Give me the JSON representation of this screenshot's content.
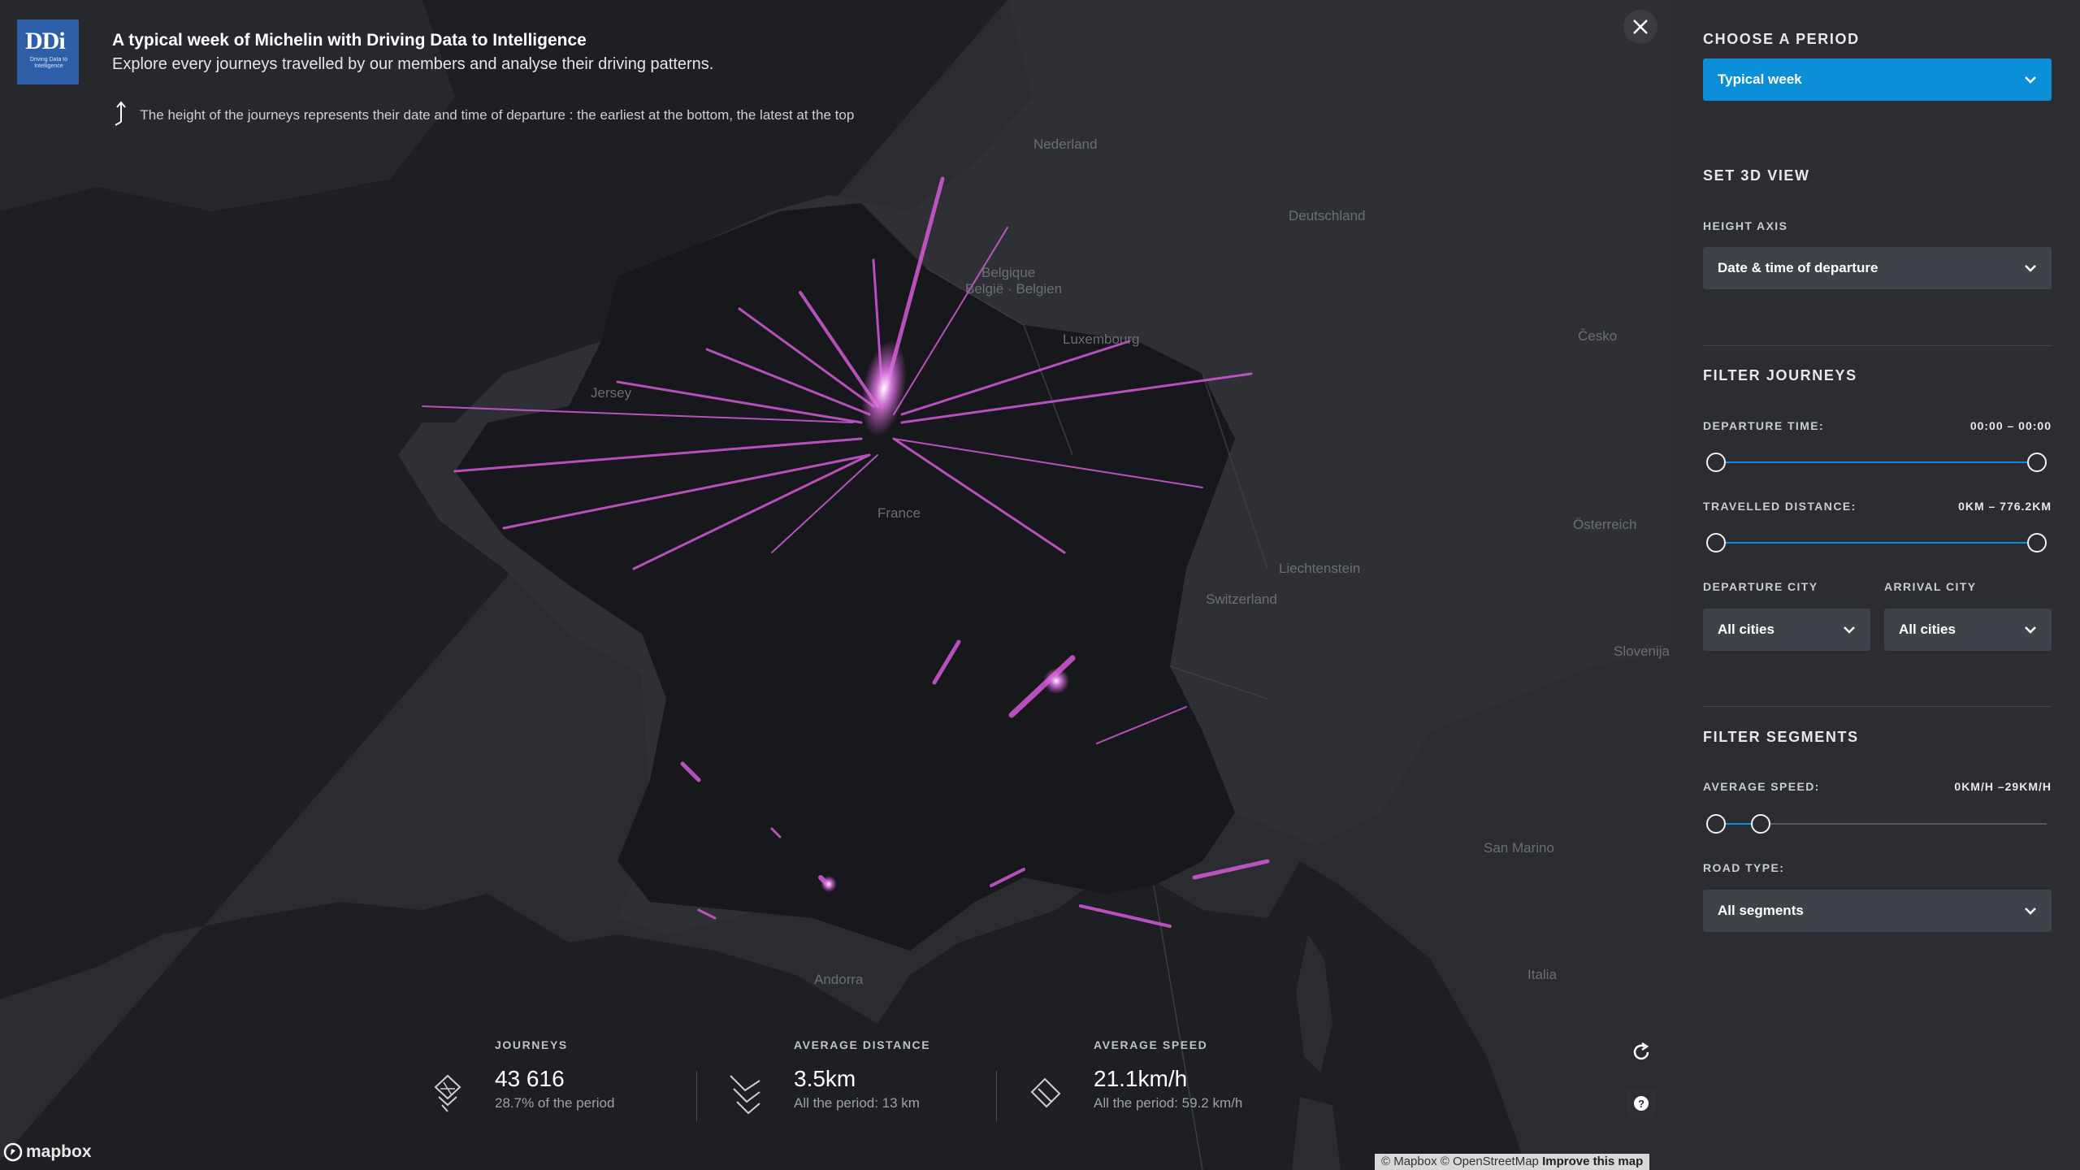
{
  "header": {
    "logo_text": "DDi",
    "logo_subtext": "Driving Data to Intelligence",
    "title": "A typical week of Michelin with Driving Data to Intelligence",
    "subtitle": "Explore every journeys travelled by our members and analyse their driving patterns.",
    "hint": "The height of the journeys represents their date and time of departure : the earliest at the bottom, the latest at the top"
  },
  "map": {
    "labels": [
      "Nederland",
      "Deutschland",
      "Belgique",
      "België · Belgien",
      "Luxembourg",
      "Česko",
      "Jersey",
      "France",
      "Österreich",
      "Liechtenstein",
      "Switzerland",
      "Slovenija",
      "San Marino",
      "Italia",
      "Andorra"
    ],
    "journey_color": "#d55ad8",
    "attribution": {
      "mapbox": "© Mapbox",
      "osm": "© OpenStreetMap",
      "improve": "Improve this map"
    },
    "brand": "mapbox"
  },
  "stats": [
    {
      "label": "JOURNEYS",
      "value": "43 616",
      "sub": "28.7% of the period",
      "icon": "journeys-icon"
    },
    {
      "label": "AVERAGE DISTANCE",
      "value": "3.5km",
      "sub": "All the period: 13 km",
      "icon": "distance-icon"
    },
    {
      "label": "AVERAGE SPEED",
      "value": "21.1km/h",
      "sub": "All the period: 59.2 km/h",
      "icon": "speed-icon"
    }
  ],
  "sidebar": {
    "period": {
      "heading": "CHOOSE A PERIOD",
      "selected": "Typical week",
      "accent": "#0a8fd8"
    },
    "view3d": {
      "heading": "SET 3D VIEW",
      "height_axis_label": "HEIGHT AXIS",
      "height_axis_value": "Date & time of departure"
    },
    "filter_journeys": {
      "heading": "FILTER JOURNEYS",
      "departure_time_label": "DEPARTURE TIME:",
      "departure_time_value": "00:00 – 00:00",
      "departure_time_range": [
        0,
        1
      ],
      "distance_label": "TRAVELLED DISTANCE:",
      "distance_value": "0KM – 776.2KM",
      "distance_range": [
        0,
        1
      ],
      "departure_city_label": "DEPARTURE CITY",
      "departure_city_value": "All cities",
      "arrival_city_label": "ARRIVAL CITY",
      "arrival_city_value": "All cities"
    },
    "filter_segments": {
      "heading": "FILTER SEGMENTS",
      "speed_label": "AVERAGE SPEED:",
      "speed_value": "0KM/H –29KM/H",
      "speed_range": [
        0,
        0.14
      ],
      "road_type_label": "ROAD TYPE:",
      "road_type_value": "All segments"
    }
  }
}
